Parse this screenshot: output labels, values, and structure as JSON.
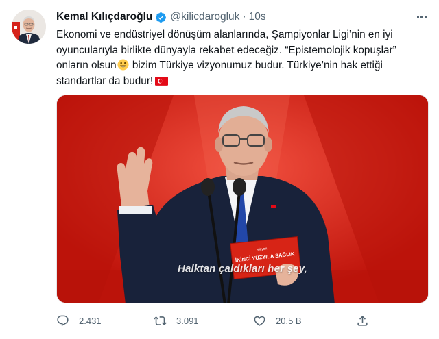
{
  "tweet": {
    "author_name": "Kemal Kılıçdaroğlu",
    "handle": "@kilicdarogluk",
    "separator": "·",
    "time": "10s",
    "text_lines": [
      "Ekonomi ve endüstriyel dönüşüm alanlarında, Şampiyonlar Ligi’nin en iyi",
      "oyuncularıyla birlikte dünyayla rekabet edeceğiz. “Epistemolojik kopuşlar”",
      "onların olsun",
      "bizim Türkiye vizyonumuz budur. Türkiye’nin hak ettiği",
      "standartlar da budur!"
    ],
    "icons": {
      "verified": "verified-badge-icon",
      "more": "more-options-icon",
      "smile": "smiling-face-emoji",
      "flag": "turkey-flag-emoji"
    },
    "media": {
      "caption": "Halktan çaldıkları her şey,",
      "booklet_title": "İKİNCİ YÜZYILA SAĞLIK",
      "booklet_small": "Vizyon"
    },
    "actions": {
      "reply_count": "2.431",
      "retweet_count": "3.091",
      "like_count": "20,5 B"
    },
    "colors": {
      "text": "#0f1419",
      "secondary": "#536471",
      "verified": "#1d9bf0",
      "stage_red": "#c61a10"
    }
  }
}
